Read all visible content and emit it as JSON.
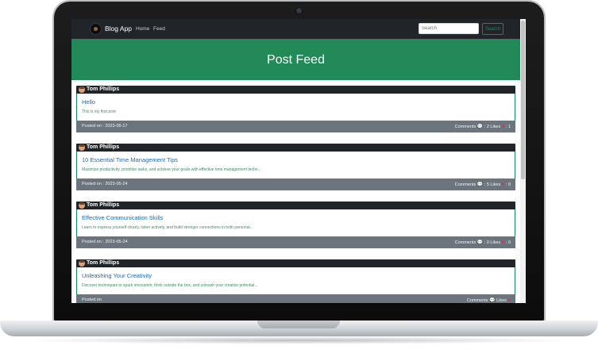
{
  "navbar": {
    "brand": "Blog App",
    "links": [
      "Home",
      "Feed"
    ],
    "search_placeholder": "Search",
    "search_button": "Search"
  },
  "hero": {
    "title": "Post Feed"
  },
  "posts": [
    {
      "author": "Tom Phillips",
      "title": "Hello",
      "excerpt": "This is my first post",
      "posted_label": "Posted on",
      "date": "2023-05-17",
      "comments_label": "Comments",
      "comments": "2",
      "likes_label": "Likes",
      "likes": "1"
    },
    {
      "author": "Tom Phillips",
      "title": "10 Essential Time Management Tips",
      "excerpt": "Maximize productivity, prioritize tasks, and achieve your goals with effective time management techn...",
      "posted_label": "Posted on",
      "date": "2023-05-24",
      "comments_label": "Comments",
      "comments": "5",
      "likes_label": "Likes",
      "likes": "0"
    },
    {
      "author": "Tom Phillips",
      "title": "Effective Communication Skills",
      "excerpt": "Learn to express yourself clearly, listen actively, and build stronger connections in both personal...",
      "posted_label": "Posted on",
      "date": "2023-05-24",
      "comments_label": "Comments",
      "comments": "0",
      "likes_label": "Likes",
      "likes": "0"
    },
    {
      "author": "Tom Phillips",
      "title": "Unleashing Your Creativity",
      "excerpt": "Discover techniques to spark innovation, think outside the box, and unleash your creative potential...",
      "posted_label": "Posted on",
      "date": "",
      "comments_label": "Comments",
      "comments": "",
      "likes_label": "Likes",
      "likes": ""
    }
  ],
  "icons": {
    "comment": "speech-bubble-icon",
    "like": "heart-icon",
    "avatar": "user-avatar-icon",
    "logo": "blog-logo-icon"
  },
  "colors": {
    "navbar": "#212529",
    "hero": "#218a58",
    "accent_green": "#198754",
    "link_blue": "#1a6bbd",
    "footer_gray": "#6c757d",
    "heart": "#dc3545"
  }
}
